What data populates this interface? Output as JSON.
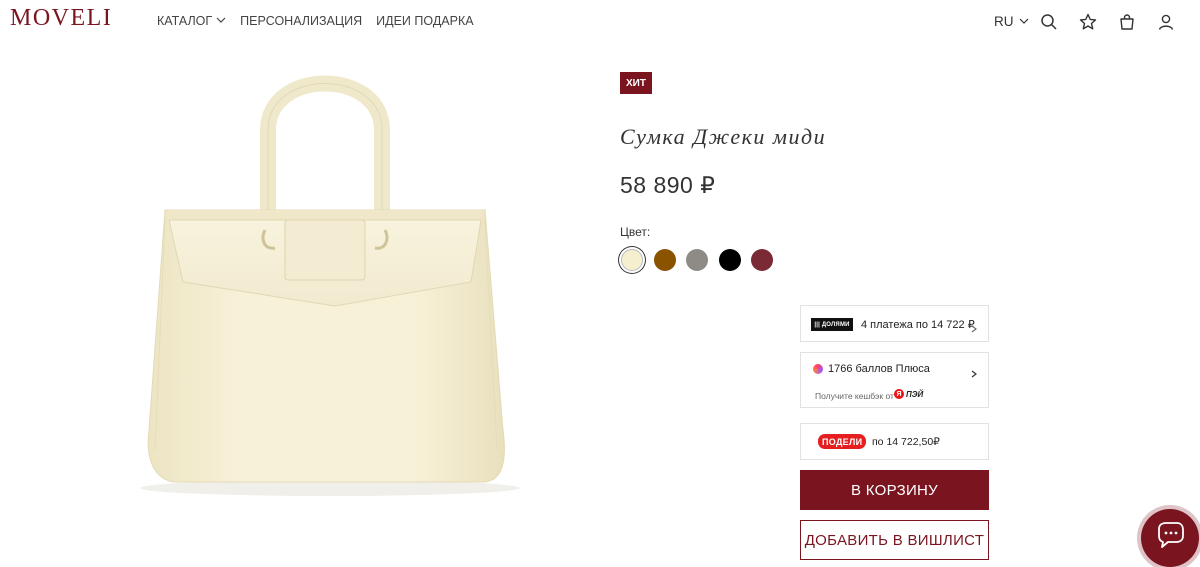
{
  "header": {
    "logo": "MOVELI",
    "nav": [
      {
        "label": "КАТАЛОГ",
        "dropdown": true
      },
      {
        "label": "ПЕРСОНАЛИЗАЦИЯ"
      },
      {
        "label": "ИДЕИ ПОДАРКА"
      }
    ],
    "language": "RU",
    "icons": [
      "search-icon",
      "star-icon",
      "bag-icon",
      "user-icon"
    ]
  },
  "product": {
    "badge": "ХИТ",
    "title": "Сумка Джеки миди",
    "price": "58 890 ₽",
    "color_label": "Цвет:",
    "colors": [
      {
        "name": "cream",
        "hex": "#f5efcf",
        "selected": true
      },
      {
        "name": "brown",
        "hex": "#8a5300"
      },
      {
        "name": "grey",
        "hex": "#8e8a86"
      },
      {
        "name": "black",
        "hex": "#000000"
      },
      {
        "name": "burgundy",
        "hex": "#7a2a35"
      }
    ]
  },
  "payments": {
    "dolyami": {
      "logo": "||| ДОЛЯМИ",
      "text": "4 платежа по 14 722 ₽"
    },
    "plus": {
      "text": "1766 баллов Плюса",
      "sub": "Получите кешбэк от",
      "pay": "ПЭЙ"
    },
    "podeli": {
      "tag": "ПОДЕЛИ",
      "text": "по 14 722,50₽"
    }
  },
  "buttons": {
    "cart": "В КОРЗИНУ",
    "wishlist": "ДОБАВИТЬ В ВИШЛИСТ"
  },
  "colors": {
    "brand": "#7a1520",
    "text": "#333333"
  }
}
